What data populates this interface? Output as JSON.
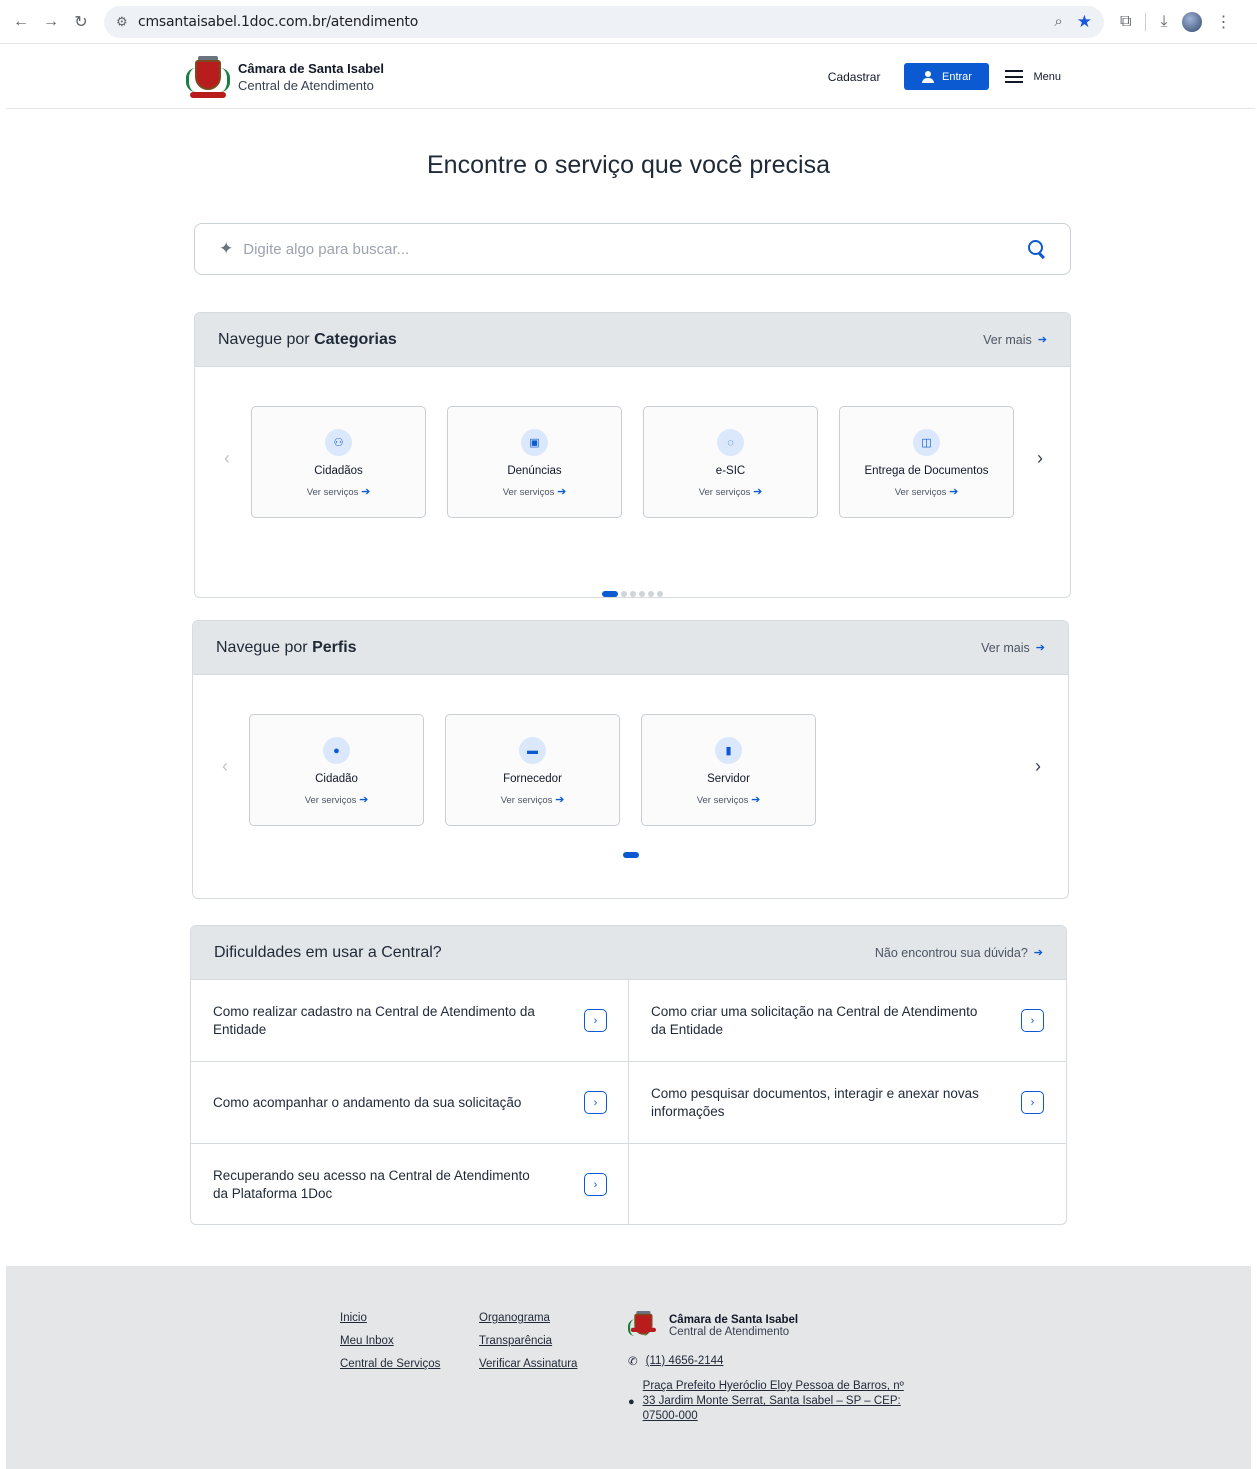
{
  "browser": {
    "url": "cmsantaisabel.1doc.com.br/atendimento"
  },
  "header": {
    "org_name": "Câmara de Santa Isabel",
    "org_sub": "Central de Atendimento",
    "cadastrar": "Cadastrar",
    "entrar": "Entrar",
    "menu": "Menu"
  },
  "hero": {
    "title": "Encontre o serviço que você precisa"
  },
  "search": {
    "placeholder": "Digite algo para buscar..."
  },
  "categorias": {
    "title_prefix": "Navegue por",
    "title_bold": "Categorias",
    "more": "Ver mais",
    "items": [
      {
        "name": "Cidadãos",
        "link": "Ver serviços",
        "icon": "user-outline-icon"
      },
      {
        "name": "Denúncias",
        "link": "Ver serviços",
        "icon": "message-report-icon"
      },
      {
        "name": "e-SIC",
        "link": "Ver serviços",
        "icon": "chat-bubble-icon"
      },
      {
        "name": "Entrega de Documentos",
        "link": "Ver serviços",
        "icon": "document-columns-icon"
      }
    ],
    "pages": 6,
    "active_page": 1
  },
  "perfis": {
    "title_prefix": "Navegue por",
    "title_bold": "Perfis",
    "more": "Ver mais",
    "items": [
      {
        "name": "Cidadão",
        "link": "Ver serviços",
        "icon": "user-solid-icon"
      },
      {
        "name": "Fornecedor",
        "link": "Ver serviços",
        "icon": "truck-icon"
      },
      {
        "name": "Servidor",
        "link": "Ver serviços",
        "icon": "id-badge-icon"
      }
    ],
    "pages": 1,
    "active_page": 1
  },
  "faq": {
    "title": "Dificuldades em usar a Central?",
    "more": "Não encontrou sua dúvida?",
    "items": [
      "Como realizar cadastro na Central de Atendimento da Entidade",
      "Como criar uma solicitação na Central de Atendimento da Entidade",
      "Como acompanhar o andamento da sua solicitação",
      "Como pesquisar documentos, interagir e anexar novas informações",
      "Recuperando seu acesso na Central de Atendimento da Plataforma 1Doc"
    ]
  },
  "footer": {
    "col1": [
      "Inicio",
      "Meu Inbox",
      "Central de Serviços"
    ],
    "col2": [
      "Organograma",
      "Transparência",
      "Verificar Assinatura"
    ],
    "org_name": "Câmara de Santa Isabel",
    "org_sub": "Central de Atendimento",
    "phone": "(11) 4656-2144",
    "address": "Praça Prefeito Hyeróclio Eloy Pessoa de Barros, nº 33 Jardim Monte Serrat, Santa Isabel – SP – CEP: 07500-000"
  },
  "colors": {
    "accent": "#0b5ad1",
    "panel_header": "#e3e6e8",
    "footer_bg": "#e4e6e8"
  }
}
